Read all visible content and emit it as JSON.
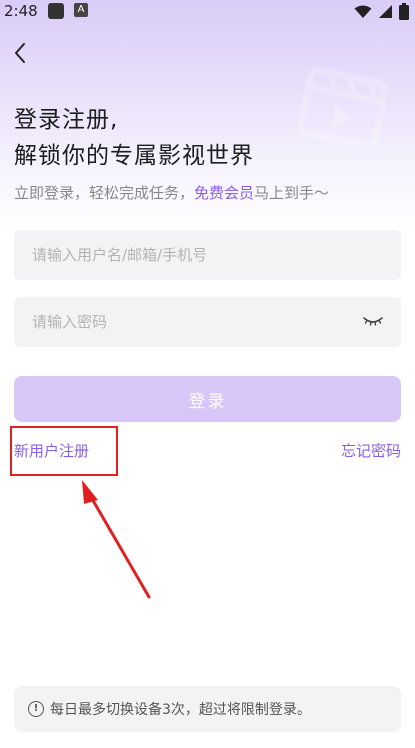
{
  "status_bar": {
    "time": "2:48",
    "app_icon_2": "A"
  },
  "icons": {
    "back": "chevron-left-icon",
    "eye": "eye-closed-icon",
    "info": "info-icon",
    "film": "clapperboard-icon"
  },
  "headline": {
    "line1": "登录注册,",
    "line2_prefix": "解锁你的",
    "line2_highlight": "专属影视",
    "line2_suffix": "世界"
  },
  "subtitle": {
    "prefix": "立即登录，轻松完成任务，",
    "highlight": "免费会员",
    "suffix": "马上到手～"
  },
  "form": {
    "username_placeholder": "请输入用户名/邮箱/手机号",
    "username_value": "",
    "password_placeholder": "请输入密码",
    "password_value": ""
  },
  "login_button": "登录",
  "register_link": "新用户注册",
  "forgot_link": "忘记密码",
  "notice": {
    "info_glyph": "!",
    "text": "每日最多切换设备3次，超过将限制登录。"
  },
  "colors": {
    "accent": "#8a5ee8",
    "button_disabled": "#d8c7f6",
    "annotation": "#e02020"
  }
}
